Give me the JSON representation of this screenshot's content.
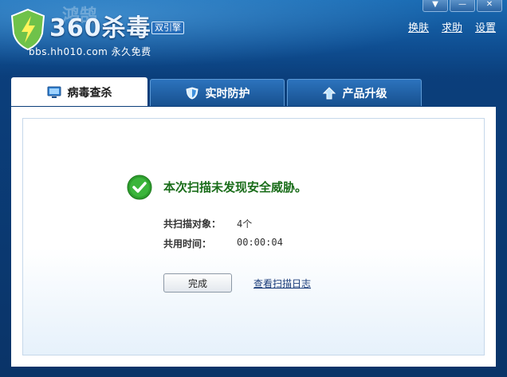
{
  "header": {
    "logo_text": "360杀毒",
    "logo_badge": "双引擎",
    "logo_sub": "bbs.hh010.com  永久免费",
    "watermark": "鸿鹄"
  },
  "window_controls": [
    "▼",
    "—",
    "✕"
  ],
  "top_links": [
    "换肤",
    "求助",
    "设置"
  ],
  "tabs": [
    {
      "label": "病毒查杀",
      "icon": "monitor-icon",
      "active": true
    },
    {
      "label": "实时防护",
      "icon": "shield-icon",
      "active": false
    },
    {
      "label": "产品升级",
      "icon": "up-arrow-icon",
      "active": false
    }
  ],
  "result": {
    "message": "本次扫描未发现安全威胁。",
    "objects_label": "共扫描对象：",
    "objects_value": "4个",
    "time_label": "共用时间：",
    "time_value": "00:00:04",
    "done_button": "完成",
    "log_link": "查看扫描日志"
  },
  "colors": {
    "frame_blue": "#0b3f7c",
    "success_green": "#1a6d1a",
    "check_green": "#2e9e2e"
  }
}
